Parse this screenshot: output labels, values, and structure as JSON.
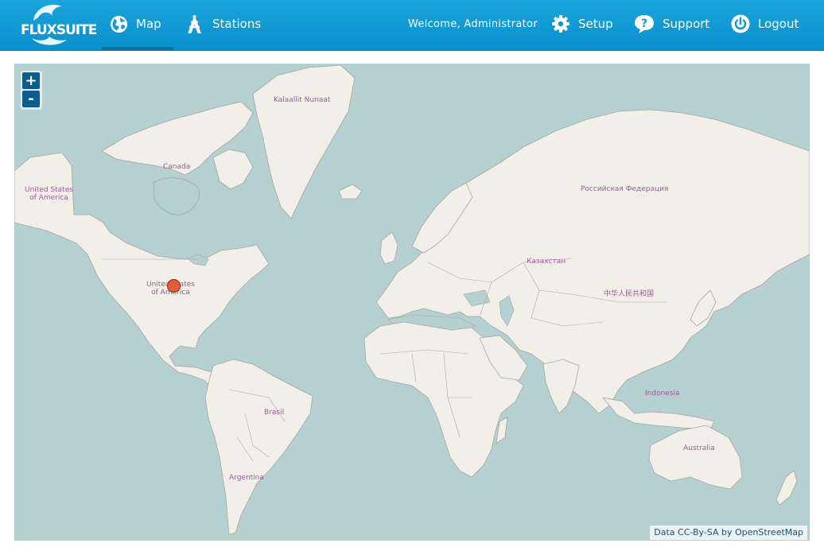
{
  "app": {
    "logo_text": "FLUXSUITE",
    "logo_mark": "®"
  },
  "nav": {
    "map": "Map",
    "stations": "Stations",
    "welcome": "Welcome, Administrator",
    "setup": "Setup",
    "support": "Support",
    "logout": "Logout"
  },
  "map": {
    "zoom_in": "+",
    "zoom_out": "-",
    "attribution": "Data CC-By-SA by OpenStreetMap",
    "labels": {
      "greenland": "Kalaallit Nunaat",
      "canada": "Canada",
      "alaska": "United States\nof America",
      "usa": "United States\nof America",
      "russia": "Российская Федерация",
      "kazakhstan": "Казахстан",
      "china": "中华人民共和国",
      "brasil": "Brasil",
      "argentina": "Argentina",
      "indonesia": "Indonesia",
      "australia": "Australia"
    },
    "marker": {
      "color": "#e25d3c"
    }
  },
  "colors": {
    "header": "#0f98d3",
    "ocean": "#b5d0d0",
    "land": "#f2efe9",
    "label": "#9c5b9a"
  }
}
